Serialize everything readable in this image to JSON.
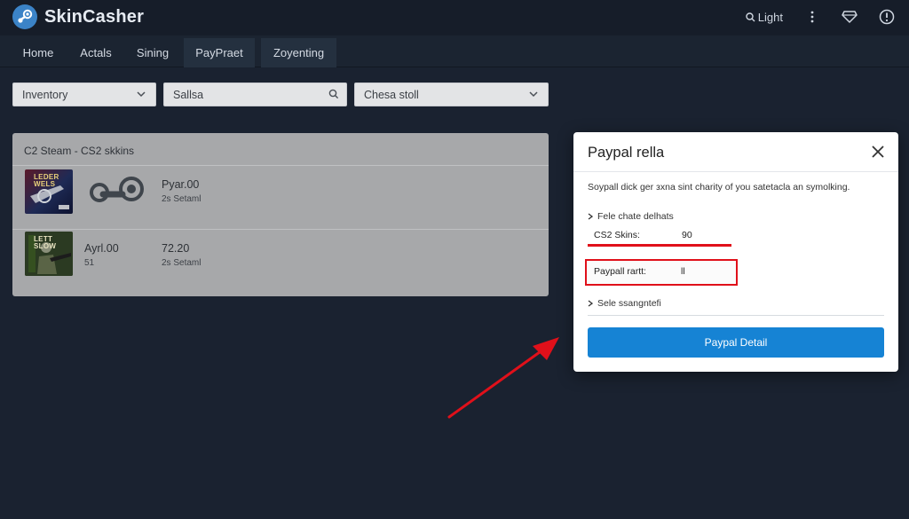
{
  "header": {
    "app_name": "SkinCasher",
    "light_label": "Light",
    "icons": [
      "steam-logo",
      "search-icon",
      "more-vertical-icon",
      "diamond-icon",
      "alert-circle-icon"
    ]
  },
  "nav": {
    "tabs": [
      {
        "label": "Home"
      },
      {
        "label": "Actals"
      },
      {
        "label": "Sining"
      },
      {
        "label": "PayPraet"
      },
      {
        "label": "Zoyenting"
      }
    ]
  },
  "filters": {
    "inventory_label": "Inventory",
    "search_value": "Sallsa",
    "sort_label": "Chesa stoll"
  },
  "panel": {
    "title": "C2 Steam - CS2 skkins",
    "rows": [
      {
        "thumb_text": "LEDER\nWELS",
        "col1_main": "",
        "col1_sub": "",
        "col2_main": "Pyar.00",
        "col2_sub": "2s Setaml"
      },
      {
        "thumb_text": "LETT\nSLOW",
        "col1_main": "Ayrl.00",
        "col1_sub": "51",
        "col2_main": "72.20",
        "col2_sub": "2s Setaml"
      }
    ]
  },
  "modal": {
    "title": "Paypal rella",
    "description": "Soypall dick ger зxna sint charity of you satetacla an symolking.",
    "section1": "Fele chate delhats",
    "cs2_label": "CS2 Skins:",
    "cs2_value": "90",
    "paypal_label": "Paypall rartt:",
    "paypal_value": "ll",
    "section2": "Sele ssangntefi",
    "cta_label": "Paypal Detail"
  },
  "colors": {
    "accent_blue": "#1683d4",
    "highlight_red": "#e0101a",
    "background": "#1a2230"
  }
}
